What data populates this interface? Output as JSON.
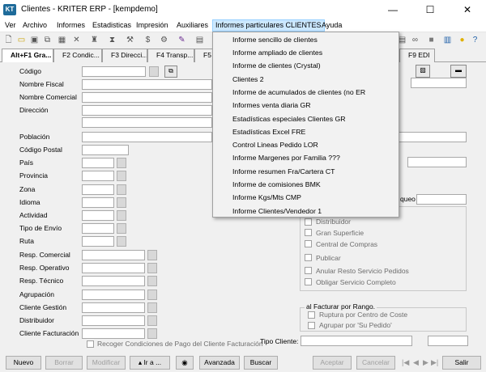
{
  "window": {
    "icon": "KT",
    "title": "Clientes - KRITER ERP - [kempdemo]",
    "minimize": "—",
    "maximize": "☐",
    "close": "✕"
  },
  "menubar": {
    "items": [
      "Ver",
      "Archivo",
      "Informes",
      "Estadisticas",
      "Impresión",
      "Auxiliares",
      "Informes particulares CLIENTES",
      "Ayuda"
    ]
  },
  "toolbar": {
    "left_icons": [
      "new-document-icon",
      "open-folder-icon",
      "save-icon",
      "copy-icon",
      "calendar-icon",
      "delete-icon",
      "stamp-icon",
      "filter-icon",
      "tool-icon",
      "dollar-icon",
      "gear-icon",
      "brush-icon",
      "grid-icon"
    ],
    "right_icons": [
      "document-icon",
      "link-icon",
      "square-icon",
      "chart-icon",
      "lightbulb-icon",
      "help-icon"
    ]
  },
  "tabs": [
    "Alt+F1 Gra...",
    "F2 Condic...",
    "F3 Direcci...",
    "F4 Transp...",
    "F5",
    "F9 EDI"
  ],
  "form": {
    "labels": [
      "Código",
      "Nombre Fiscal",
      "Nombre Comercial",
      "Dirección",
      "Población",
      "Código Postal",
      "País",
      "Provincia",
      "Zona",
      "Idioma",
      "Actividad",
      "Tipo de Envío",
      "Ruta",
      "Resp. Comercial",
      "Resp. Operativo",
      "Resp. Técnico",
      "Agrupación",
      "Cliente Gestión",
      "Distribuidor",
      "Cliente Facturación"
    ],
    "recoger_label": "Recoger Condiciones de Pago del Cliente Facturación",
    "tipo_cliente_label": "Tipo Cliente:",
    "right_partial_label": "queo",
    "checkboxes": [
      "Distribuidor",
      "Gran Superficie",
      "Central de Compras",
      "Publicar",
      "Anular Resto Servicio Pedidos",
      "Obligar Servicio Completo"
    ],
    "facturar_group": {
      "title": "al Facturar por Rango.",
      "options": [
        "Ruptura por Centro de Coste",
        "Agrupar por 'Su Pedido'"
      ]
    }
  },
  "dropdown": {
    "items": [
      "Informe sencillo de clientes",
      "Informe ampliado de clientes",
      "Informe de clientes (Crystal)",
      "Clientes 2",
      "Informe de acumulados de clientes (no ER",
      "Informes venta diaria GR",
      "Estadísticas especiales Clientes GR",
      "Estadísticas Excel FRE",
      "Control Lineas Pedido LOR",
      "Informe Margenes por Familia ???",
      "Informe resumen Fra/Cartera CT",
      "Informe de comisiones BMK",
      "Informe Kgs/Mts CMP",
      "Informe Clientes/Vendedor 1"
    ]
  },
  "bottom": {
    "nuevo": "Nuevo",
    "borrar": "Borrar",
    "modificar": "Modificar",
    "ir_a": "▴ Ir a ...",
    "avanzada": "Avanzada",
    "buscar": "Buscar",
    "aceptar": "Aceptar",
    "cancelar": "Cancelar",
    "salir": "Salir",
    "nav": [
      "|◀",
      "◀",
      "▶",
      "▶|"
    ]
  }
}
